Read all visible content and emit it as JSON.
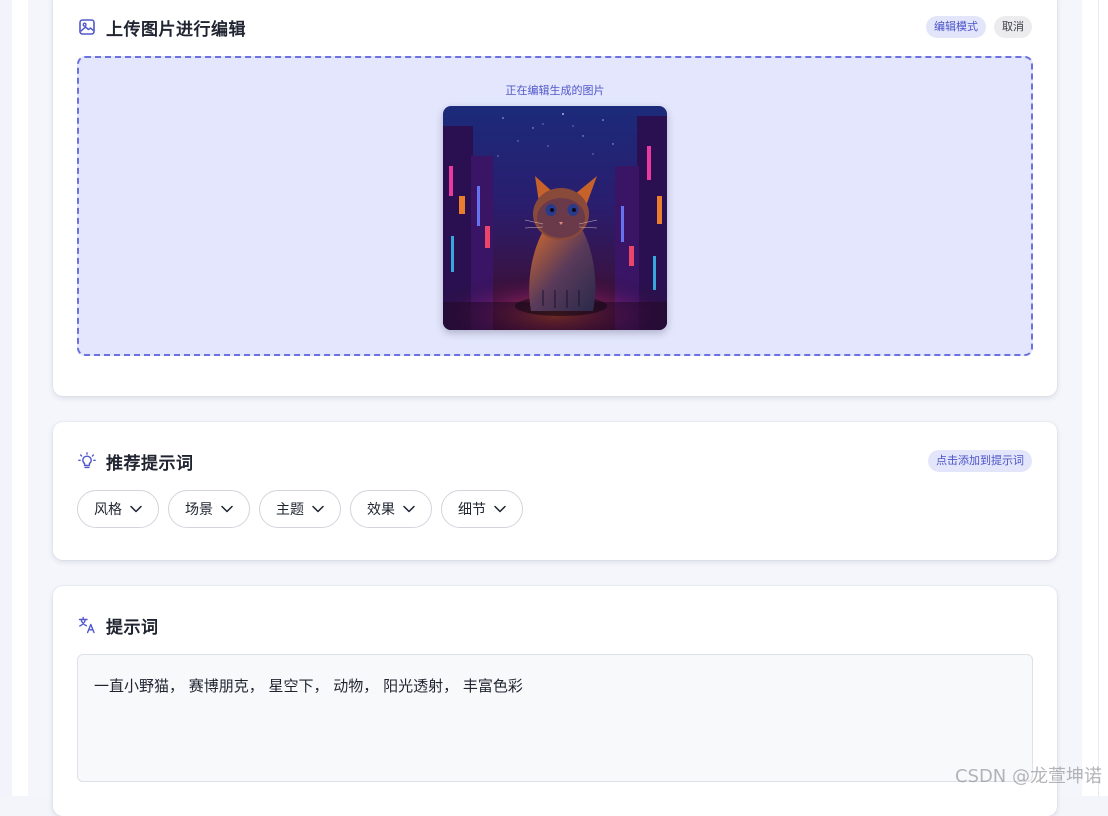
{
  "upload": {
    "title": "上传图片进行编辑",
    "mode_badge": "编辑模式",
    "cancel_label": "取消",
    "editing_label": "正在编辑生成的图片"
  },
  "suggest": {
    "title": "推荐提示词",
    "add_badge": "点击添加到提示词",
    "chips": [
      {
        "label": "风格"
      },
      {
        "label": "场景"
      },
      {
        "label": "主题"
      },
      {
        "label": "效果"
      },
      {
        "label": "细节"
      }
    ]
  },
  "prompt": {
    "title": "提示词",
    "value": "一直小野猫， 赛博朋克， 星空下， 动物， 阳光透射， 丰富色彩"
  },
  "watermark": "CSDN @龙萱坤诺",
  "icons": {
    "upload": "image-icon",
    "suggest": "lightbulb-icon",
    "prompt": "translate-icon",
    "chip": "chevron-down-icon"
  },
  "colors": {
    "accent": "#5058c9",
    "dropzone_bg": "#e3e6fc",
    "dropzone_border": "#6b72e0"
  }
}
